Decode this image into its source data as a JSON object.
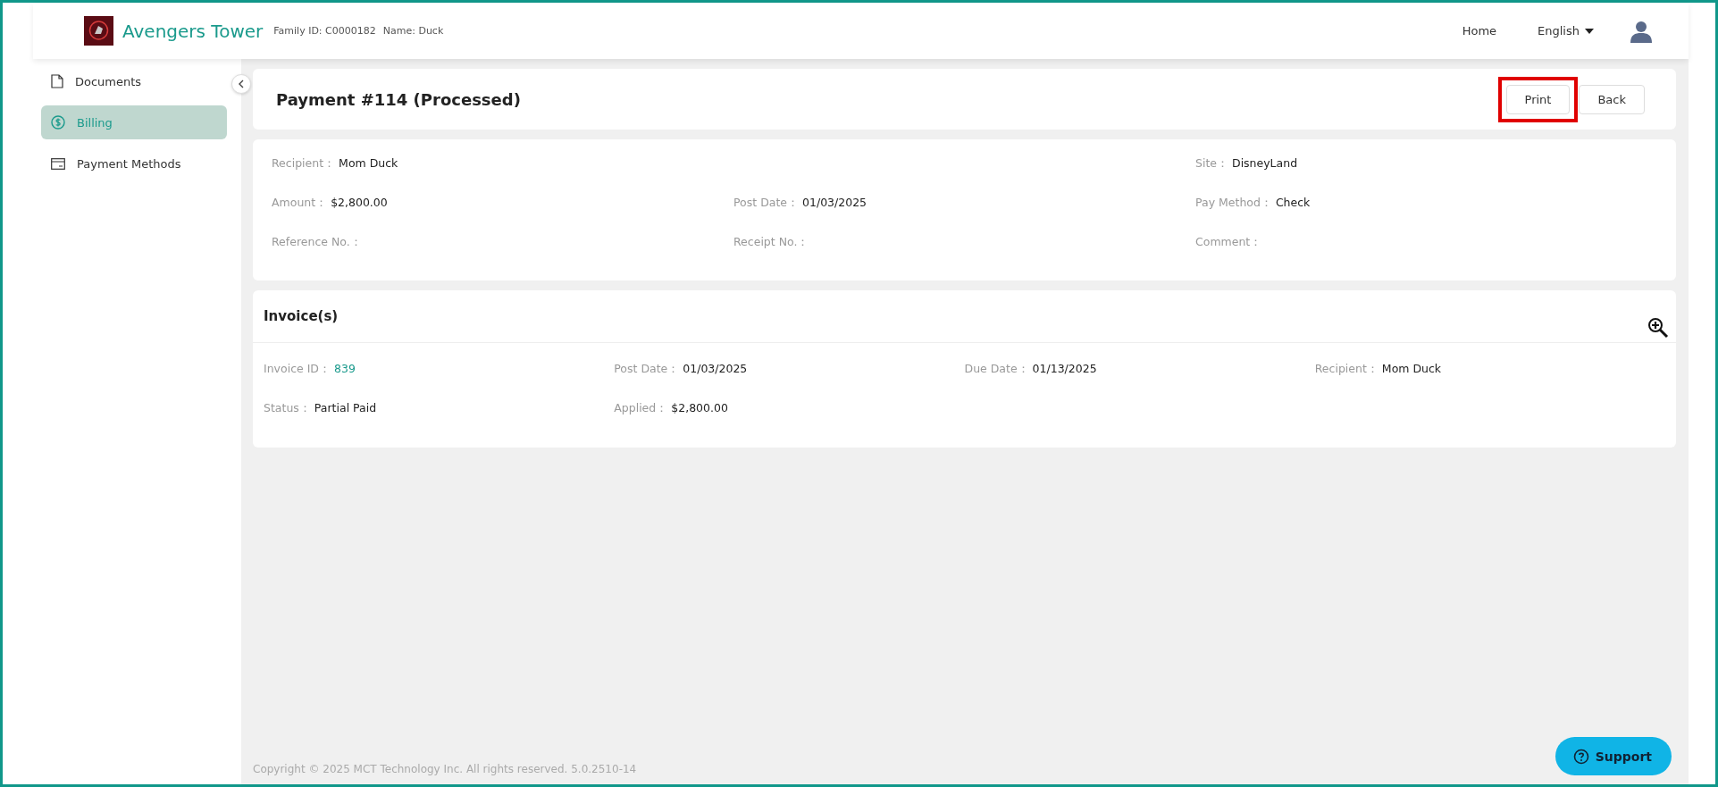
{
  "header": {
    "brand": "Avengers Tower",
    "family_id": "Family ID: C0000182",
    "name": "Name: Duck",
    "home": "Home",
    "language": "English"
  },
  "sidebar": {
    "items": [
      {
        "label": "Documents",
        "selected": false
      },
      {
        "label": "Billing",
        "selected": true
      },
      {
        "label": "Payment Methods",
        "selected": false
      }
    ]
  },
  "payment": {
    "title": "Payment #114 (Processed)",
    "buttons": [
      {
        "label": "Print",
        "highlighted": true
      },
      {
        "label": "Back",
        "highlighted": false
      }
    ]
  },
  "details": {
    "rows": [
      [
        {
          "label": "Recipient：",
          "value": "Mom Duck"
        },
        null,
        {
          "label": "Site：",
          "value": "DisneyLand"
        }
      ],
      [
        {
          "label": "Amount：",
          "value": "$2,800.00"
        },
        {
          "label": "Post Date：",
          "value": "01/03/2025"
        },
        {
          "label": "Pay Method：",
          "value": "Check"
        }
      ],
      [
        {
          "label": "Reference No.："
        },
        {
          "label": "Receipt No.："
        },
        {
          "label": "Comment："
        }
      ]
    ]
  },
  "invoices": {
    "title": "Invoice(s)",
    "rows": [
      [
        {
          "label": "Invoice ID：",
          "value": "839",
          "kind": "link"
        },
        {
          "label": "Post Date：",
          "value": "01/03/2025",
          "kind": "text"
        },
        {
          "label": "Due Date：",
          "value": "01/13/2025",
          "kind": "text"
        },
        {
          "label": "Recipient：",
          "value": "Mom Duck",
          "kind": "text"
        }
      ],
      [
        {
          "label": "Status：",
          "value": "Partial Paid",
          "kind": "text"
        },
        {
          "label": "Applied：",
          "value": "$2,800.00",
          "kind": "text"
        }
      ]
    ]
  },
  "footer": {
    "copyright": "Copyright © 2025 MCT Technology Inc. All rights reserved. 5.0.2510-14",
    "support": "Support"
  }
}
